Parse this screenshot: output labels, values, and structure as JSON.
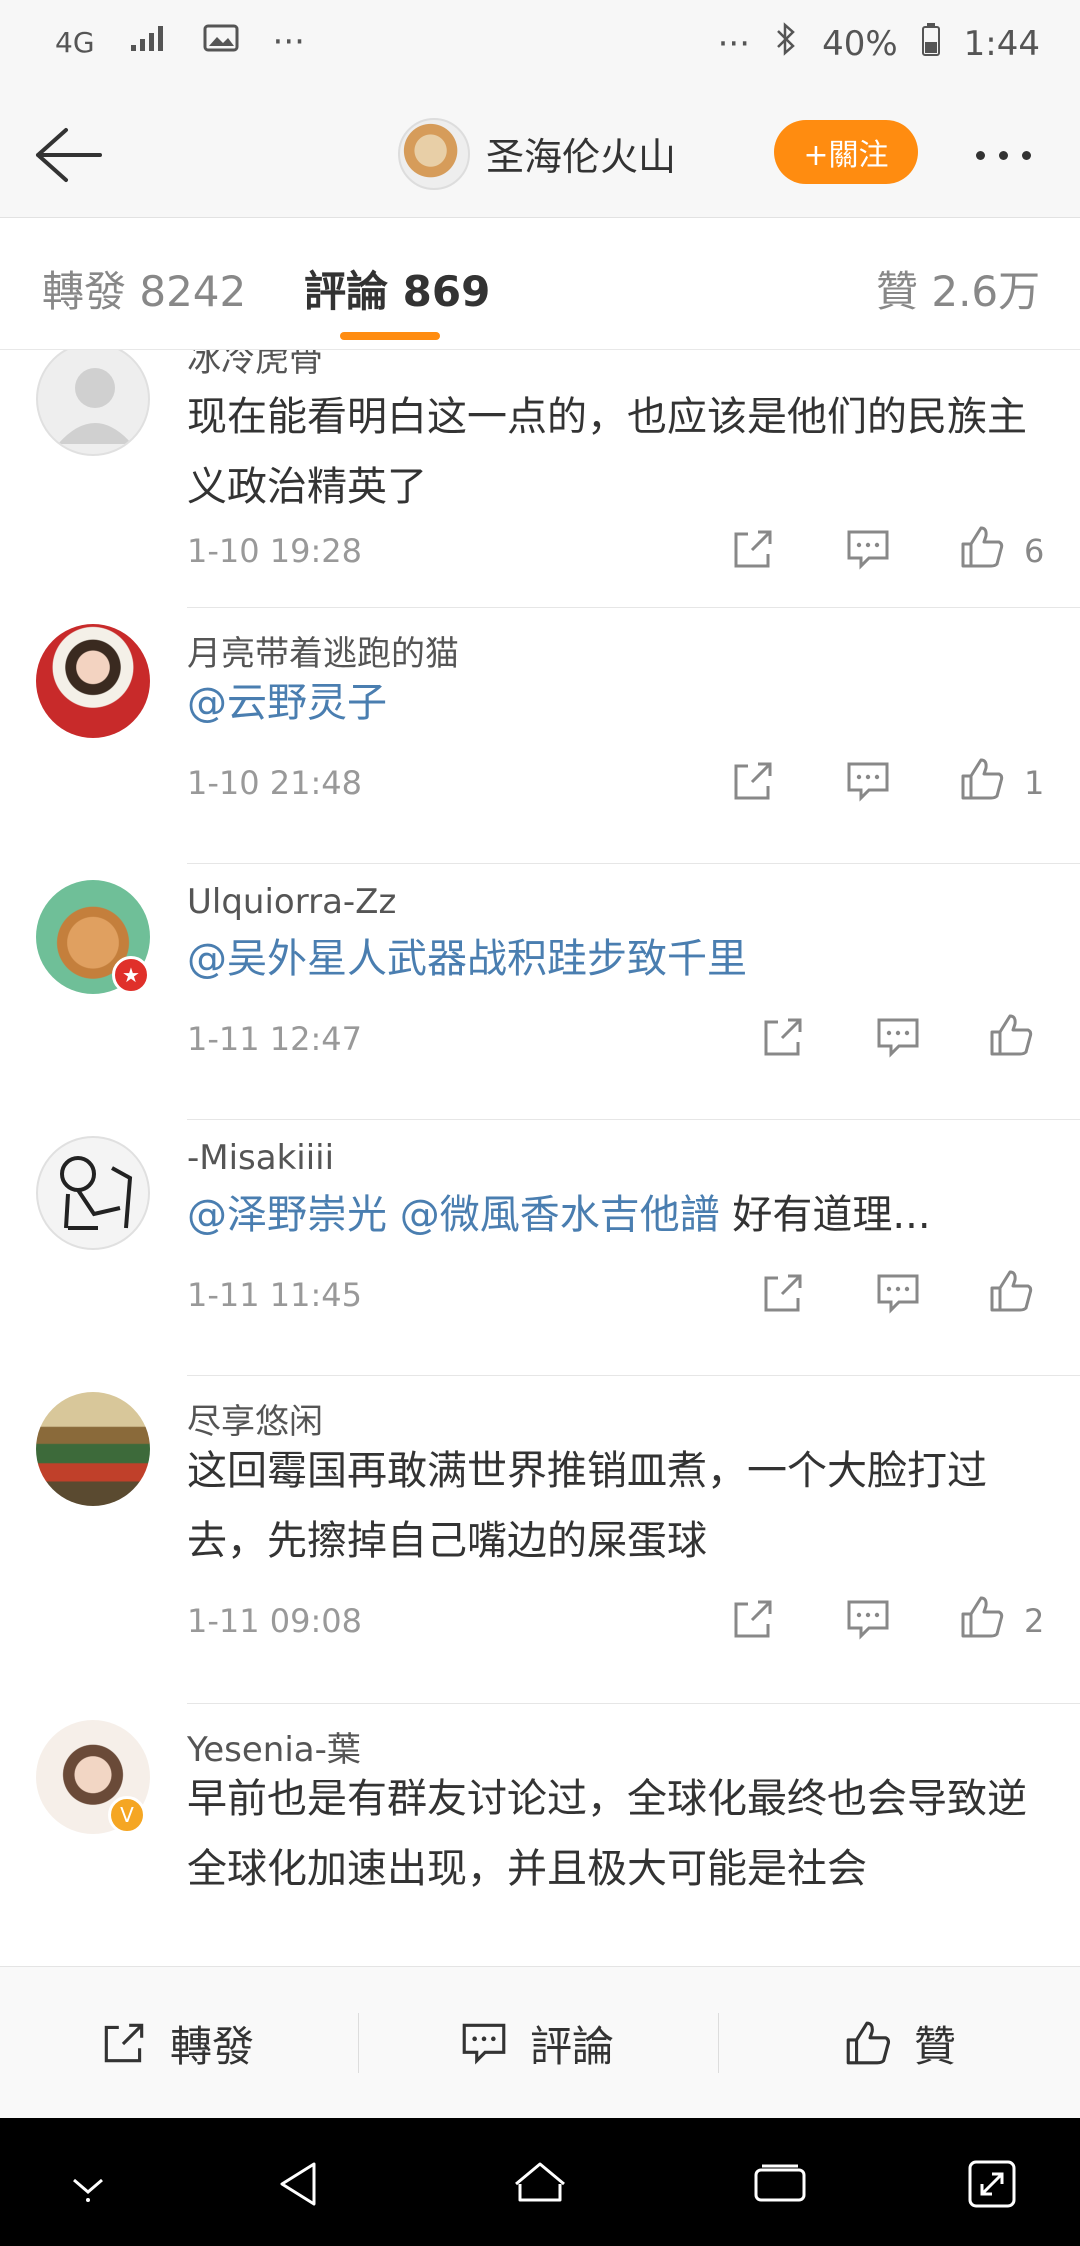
{
  "status_bar": {
    "network": "4G",
    "overflow": "···",
    "overflow_right": "···",
    "battery": "40%",
    "time": "1:44"
  },
  "header": {
    "title": "圣海伦火山",
    "follow_label": "+關注"
  },
  "tabs": [
    {
      "label": "轉發 8242"
    },
    {
      "label": "評論 869"
    },
    {
      "label": "贊 2.6万"
    }
  ],
  "comments": [
    {
      "username": "冰冷虎骨",
      "text_plain": "现在能看明白这一点的，也应该是他们的民族主义政治精英了",
      "time": "1-10 19:28",
      "likes": "6",
      "avatar": "default-avatar"
    },
    {
      "username": "月亮带着逃跑的猫",
      "mention": "@云野灵子",
      "time": "1-10 21:48",
      "likes": "1",
      "avatar": "girl-red-hat"
    },
    {
      "username": "Ulquiorra-Zz",
      "mention": "@吴外星人武器战积跬步致千里",
      "time": "1-11 12:47",
      "likes": "",
      "avatar": "cartoon-deer",
      "badge_color": "#e0302a"
    },
    {
      "username": "-Misakiiii",
      "mention": "@泽野崇光 @微風香水吉他譜",
      "text_after": " 好有道理...",
      "time": "1-11 11:45",
      "likes": "",
      "avatar": "sketch-figure"
    },
    {
      "username": "尽享悠闲",
      "text_plain": "这回霉国再敢满世界推销皿煮，一个大脸打过去，先擦掉自己嘴边的屎蛋球",
      "time": "1-11 09:08",
      "likes": "2",
      "avatar": "parliament-hall"
    },
    {
      "username": "Yesenia-葉",
      "text_plain": "早前也是有群友讨论过，全球化最终也会导致逆全球化加速出现，并且极大可能是社会",
      "time": "",
      "likes": "",
      "avatar": "girl-glasses",
      "badge_color": "#f5a623"
    }
  ],
  "bottom_bar": {
    "repost": "轉發",
    "comment": "評論",
    "like": "贊"
  },
  "colors": {
    "accent": "#ff8c10",
    "mention": "#4a7eb0"
  }
}
